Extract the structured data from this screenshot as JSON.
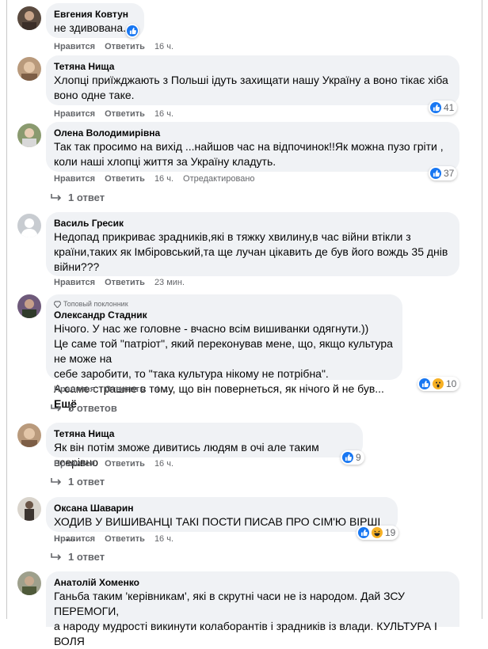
{
  "ui": {
    "like": "Нравится",
    "reply": "Ответить",
    "more": "Ещё"
  },
  "comments": [
    {
      "author": "Евгения Ковтун",
      "text": "не здивована.",
      "time": "16 ч."
    },
    {
      "author": "Тетяна Нища",
      "text": "Хлопці приїжджають з Польші ідуть захищати нашу Україну а воно тікає хіба\nвоно одне таке.",
      "time": "16 ч.",
      "reactions": "41"
    },
    {
      "author": "Олена Володимирівна",
      "text": "Так так просимо на вихід ...найшов час на відпочинок!!Як можна пузо гріти ,\nколи наші хлопці життя за Україну кладуть.",
      "time": "16 ч.",
      "edited": "Отредактировано",
      "reactions": "37",
      "replies": "1 ответ"
    },
    {
      "author": "Василь Гресик",
      "text": "Недопад прикриває зрадників,які в тяжку хвилину,в час війни втікли з\nкраїни,таких як Імбіровський,та ще лучан цікавить де був його вождь 35 днів\nвійни???",
      "time": "23 мин."
    },
    {
      "badge": "Топовый поклонник",
      "author": "Олександр Стадник",
      "text": "Нічого. У нас же головне - вчасно всім вишиванки одягнути.))\nЦе саме той \"патріот\", який переконував мене, що, якщо культура не може на\nсебе заробити, то \"така культура нікому не потрібна\".\nА саме страшне в тому, що він повернеться, як нічого й не був...",
      "time": "4 ч.",
      "reactions": "10",
      "replies": "5 ответов"
    },
    {
      "author": "Тетяна Нища",
      "text": "Як він потім зможе дивитись людям в очі але таким всерівно",
      "time": "16 ч.",
      "reactions": "9",
      "replies": "1 ответ"
    },
    {
      "author": "Оксана Шаварин",
      "text": "ХОДИВ У ВИШИВАНЦІ ТАКІ ПОСТИ ПИСАВ ПРО СІМ'Ю ВІРШІ ............",
      "time": "16 ч.",
      "reactions": "19",
      "replies": "1 ответ"
    },
    {
      "author": "Анатолій Хоменко",
      "text": "Ганьба таким 'керівникам', які в скрутні часи не із народом. Дай ЗСУ ПЕРЕМОГИ,\nа народу мудрості викинути колаборантів і зрадників із влади. КУЛЬТУРА І ВОЛЯ"
    }
  ],
  "colors": {
    "bubble": "#f0f2f5",
    "meta": "#65676b",
    "like": "#1877f2",
    "haha": "#f7b125"
  }
}
